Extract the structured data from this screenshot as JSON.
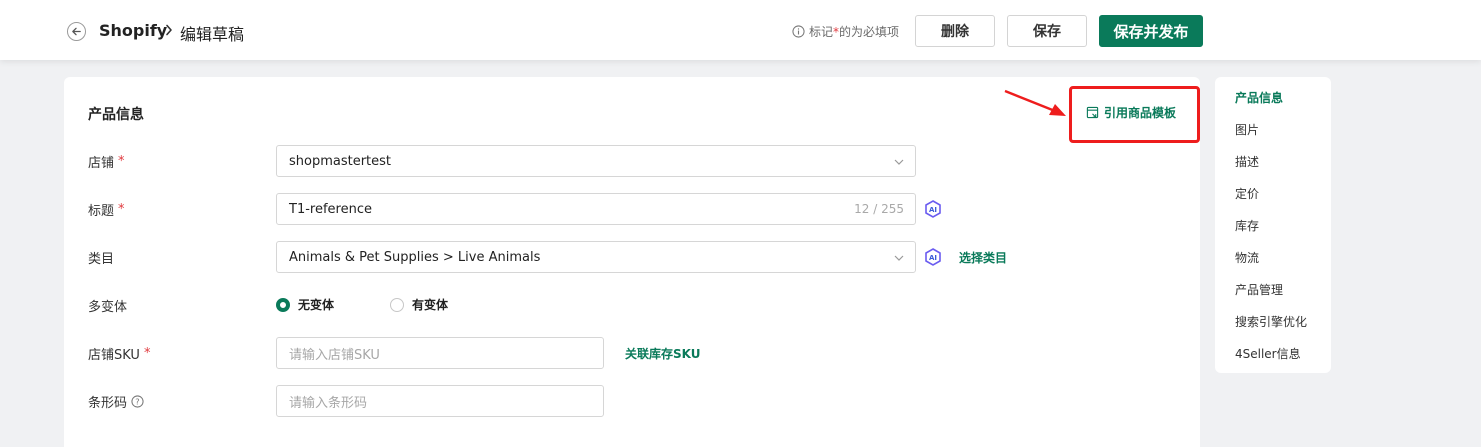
{
  "header": {
    "breadcrumb_root": "Shopify",
    "breadcrumb_current": "编辑草稿",
    "required_hint_prefix": "标记",
    "required_hint_star": "*",
    "required_hint_suffix": "的为必填项",
    "delete_label": "删除",
    "save_label": "保存",
    "publish_label": "保存并发布"
  },
  "section": {
    "title": "产品信息",
    "template_link": "引用商品模板"
  },
  "form": {
    "store": {
      "label": "店铺",
      "required": "*",
      "value": "shopmastertest"
    },
    "title": {
      "label": "标题",
      "required": "*",
      "value": "T1-reference",
      "counter": "12 / 255"
    },
    "category": {
      "label": "类目",
      "value": "Animals & Pet Supplies > Live Animals",
      "link": "选择类目"
    },
    "variants": {
      "label": "多变体",
      "option_none": "无变体",
      "option_has": "有变体",
      "selected": "无变体"
    },
    "sku": {
      "label": "店铺SKU",
      "required": "*",
      "placeholder": "请输入店铺SKU",
      "link": "关联库存SKU"
    },
    "barcode": {
      "label": "条形码",
      "placeholder": "请输入条形码"
    }
  },
  "sidebar": {
    "items": [
      {
        "label": "产品信息",
        "active": true
      },
      {
        "label": "图片"
      },
      {
        "label": "描述"
      },
      {
        "label": "定价"
      },
      {
        "label": "库存"
      },
      {
        "label": "物流"
      },
      {
        "label": "产品管理"
      },
      {
        "label": "搜索引擎优化"
      },
      {
        "label": "4Seller信息"
      }
    ]
  },
  "colors": {
    "accent": "#0a7a5a",
    "required": "#e0393e",
    "highlight": "#ee1d1d",
    "background": "#f0f1f3"
  }
}
